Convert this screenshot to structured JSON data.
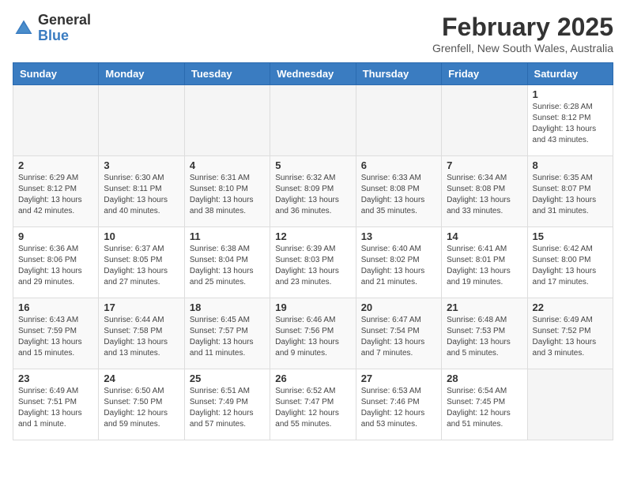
{
  "header": {
    "logo_line1": "General",
    "logo_line2": "Blue",
    "month_year": "February 2025",
    "location": "Grenfell, New South Wales, Australia"
  },
  "weekdays": [
    "Sunday",
    "Monday",
    "Tuesday",
    "Wednesday",
    "Thursday",
    "Friday",
    "Saturday"
  ],
  "weeks": [
    [
      {
        "day": "",
        "info": ""
      },
      {
        "day": "",
        "info": ""
      },
      {
        "day": "",
        "info": ""
      },
      {
        "day": "",
        "info": ""
      },
      {
        "day": "",
        "info": ""
      },
      {
        "day": "",
        "info": ""
      },
      {
        "day": "1",
        "info": "Sunrise: 6:28 AM\nSunset: 8:12 PM\nDaylight: 13 hours and 43 minutes."
      }
    ],
    [
      {
        "day": "2",
        "info": "Sunrise: 6:29 AM\nSunset: 8:12 PM\nDaylight: 13 hours and 42 minutes."
      },
      {
        "day": "3",
        "info": "Sunrise: 6:30 AM\nSunset: 8:11 PM\nDaylight: 13 hours and 40 minutes."
      },
      {
        "day": "4",
        "info": "Sunrise: 6:31 AM\nSunset: 8:10 PM\nDaylight: 13 hours and 38 minutes."
      },
      {
        "day": "5",
        "info": "Sunrise: 6:32 AM\nSunset: 8:09 PM\nDaylight: 13 hours and 36 minutes."
      },
      {
        "day": "6",
        "info": "Sunrise: 6:33 AM\nSunset: 8:08 PM\nDaylight: 13 hours and 35 minutes."
      },
      {
        "day": "7",
        "info": "Sunrise: 6:34 AM\nSunset: 8:08 PM\nDaylight: 13 hours and 33 minutes."
      },
      {
        "day": "8",
        "info": "Sunrise: 6:35 AM\nSunset: 8:07 PM\nDaylight: 13 hours and 31 minutes."
      }
    ],
    [
      {
        "day": "9",
        "info": "Sunrise: 6:36 AM\nSunset: 8:06 PM\nDaylight: 13 hours and 29 minutes."
      },
      {
        "day": "10",
        "info": "Sunrise: 6:37 AM\nSunset: 8:05 PM\nDaylight: 13 hours and 27 minutes."
      },
      {
        "day": "11",
        "info": "Sunrise: 6:38 AM\nSunset: 8:04 PM\nDaylight: 13 hours and 25 minutes."
      },
      {
        "day": "12",
        "info": "Sunrise: 6:39 AM\nSunset: 8:03 PM\nDaylight: 13 hours and 23 minutes."
      },
      {
        "day": "13",
        "info": "Sunrise: 6:40 AM\nSunset: 8:02 PM\nDaylight: 13 hours and 21 minutes."
      },
      {
        "day": "14",
        "info": "Sunrise: 6:41 AM\nSunset: 8:01 PM\nDaylight: 13 hours and 19 minutes."
      },
      {
        "day": "15",
        "info": "Sunrise: 6:42 AM\nSunset: 8:00 PM\nDaylight: 13 hours and 17 minutes."
      }
    ],
    [
      {
        "day": "16",
        "info": "Sunrise: 6:43 AM\nSunset: 7:59 PM\nDaylight: 13 hours and 15 minutes."
      },
      {
        "day": "17",
        "info": "Sunrise: 6:44 AM\nSunset: 7:58 PM\nDaylight: 13 hours and 13 minutes."
      },
      {
        "day": "18",
        "info": "Sunrise: 6:45 AM\nSunset: 7:57 PM\nDaylight: 13 hours and 11 minutes."
      },
      {
        "day": "19",
        "info": "Sunrise: 6:46 AM\nSunset: 7:56 PM\nDaylight: 13 hours and 9 minutes."
      },
      {
        "day": "20",
        "info": "Sunrise: 6:47 AM\nSunset: 7:54 PM\nDaylight: 13 hours and 7 minutes."
      },
      {
        "day": "21",
        "info": "Sunrise: 6:48 AM\nSunset: 7:53 PM\nDaylight: 13 hours and 5 minutes."
      },
      {
        "day": "22",
        "info": "Sunrise: 6:49 AM\nSunset: 7:52 PM\nDaylight: 13 hours and 3 minutes."
      }
    ],
    [
      {
        "day": "23",
        "info": "Sunrise: 6:49 AM\nSunset: 7:51 PM\nDaylight: 13 hours and 1 minute."
      },
      {
        "day": "24",
        "info": "Sunrise: 6:50 AM\nSunset: 7:50 PM\nDaylight: 12 hours and 59 minutes."
      },
      {
        "day": "25",
        "info": "Sunrise: 6:51 AM\nSunset: 7:49 PM\nDaylight: 12 hours and 57 minutes."
      },
      {
        "day": "26",
        "info": "Sunrise: 6:52 AM\nSunset: 7:47 PM\nDaylight: 12 hours and 55 minutes."
      },
      {
        "day": "27",
        "info": "Sunrise: 6:53 AM\nSunset: 7:46 PM\nDaylight: 12 hours and 53 minutes."
      },
      {
        "day": "28",
        "info": "Sunrise: 6:54 AM\nSunset: 7:45 PM\nDaylight: 12 hours and 51 minutes."
      },
      {
        "day": "",
        "info": ""
      }
    ]
  ]
}
